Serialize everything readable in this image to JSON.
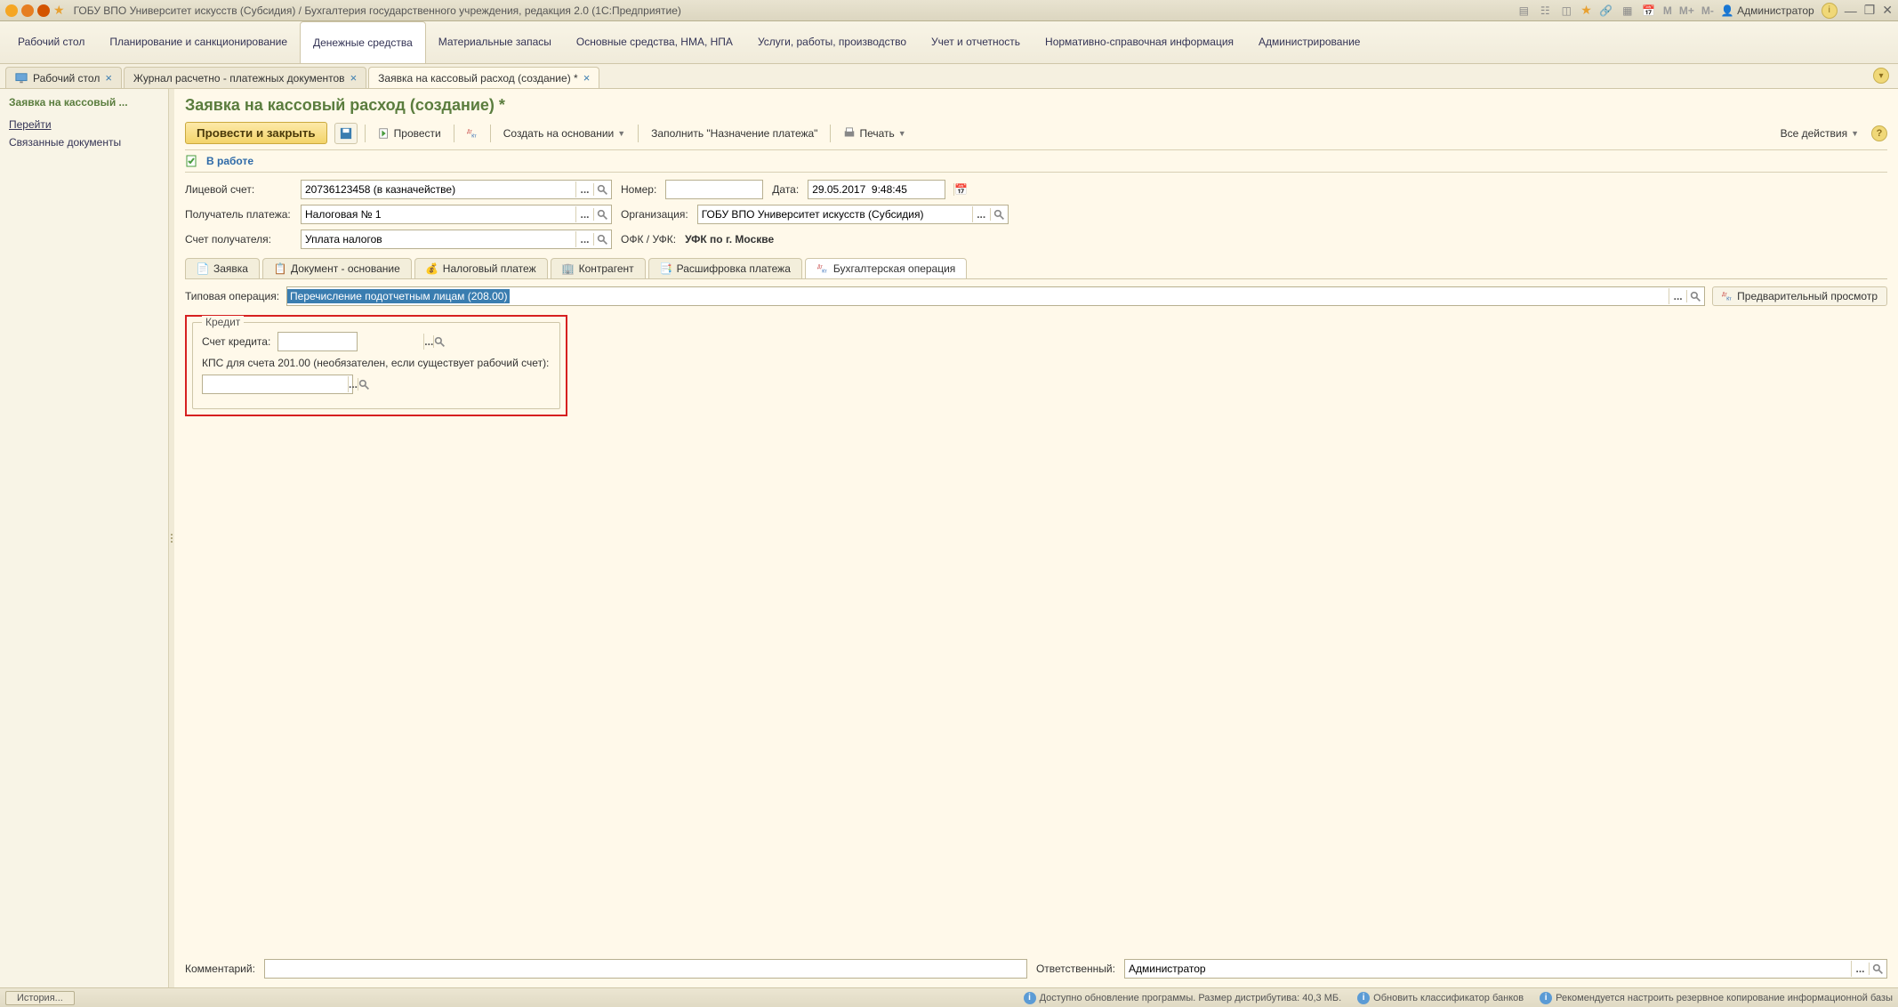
{
  "titlebar": {
    "title": "ГОБУ ВПО Университет искусств (Субсидия) / Бухгалтерия государственного учреждения, редакция 2.0  (1С:Предприятие)",
    "user": "Администратор",
    "m1": "M",
    "m2": "M+",
    "m3": "M-"
  },
  "menus": [
    "Рабочий стол",
    "Планирование и санкционирование",
    "Денежные средства",
    "Материальные запасы",
    "Основные средства, НМА, НПА",
    "Услуги, работы, производство",
    "Учет и отчетность",
    "Нормативно-справочная информация",
    "Администрирование"
  ],
  "tabs": [
    {
      "label": "Рабочий стол"
    },
    {
      "label": "Журнал расчетно - платежных документов"
    },
    {
      "label": "Заявка на кассовый расход (создание) *"
    }
  ],
  "sidebar": {
    "title": "Заявка на кассовый ...",
    "links": [
      "Перейти",
      "Связанные документы"
    ]
  },
  "page": {
    "title": "Заявка на кассовый расход (создание) *",
    "toolbar": {
      "primary": "Провести и закрыть",
      "provesti": "Провести",
      "create_base": "Создать на основании",
      "fill_np": "Заполнить \"Назначение платежа\"",
      "print": "Печать",
      "all_actions": "Все действия"
    },
    "status": "В работе",
    "fields": {
      "lic_schet_lbl": "Лицевой счет:",
      "lic_schet": "20736123458 (в казначействе)",
      "nomer_lbl": "Номер:",
      "nomer": "",
      "data_lbl": "Дата:",
      "data": "29.05.2017  9:48:45",
      "polu_lbl": "Получатель платежа:",
      "polu": "Налоговая № 1",
      "org_lbl": "Организация:",
      "org": "ГОБУ ВПО Университет искусств (Субсидия)",
      "schet_lbl": "Счет получателя:",
      "schet": "Уплата налогов",
      "ofk_lbl": "ОФК / УФК:",
      "ofk": "УФК по г. Москве"
    },
    "subtabs": [
      "Заявка",
      "Документ - основание",
      "Налоговый платеж",
      "Контрагент",
      "Расшифровка платежа",
      "Бухгалтерская операция"
    ],
    "typ_op_lbl": "Типовая операция:",
    "typ_op": "Перечисление подотчетным лицам (208.00)",
    "preview": "Предварительный просмотр",
    "kredit": {
      "legend": "Кредит",
      "sk_lbl": "Счет кредита:",
      "kps_lbl": "КПС для счета 201.00 (необязателен, если существует рабочий счет):"
    },
    "comment_lbl": "Комментарий:",
    "resp_lbl": "Ответственный:",
    "resp": "Администратор"
  },
  "statusbar": {
    "history": "История...",
    "s1": "Доступно обновление программы. Размер дистрибутива: 40,3 МБ.",
    "s2": "Обновить классификатор банков",
    "s3": "Рекомендуется настроить резервное копирование информационной базы"
  }
}
